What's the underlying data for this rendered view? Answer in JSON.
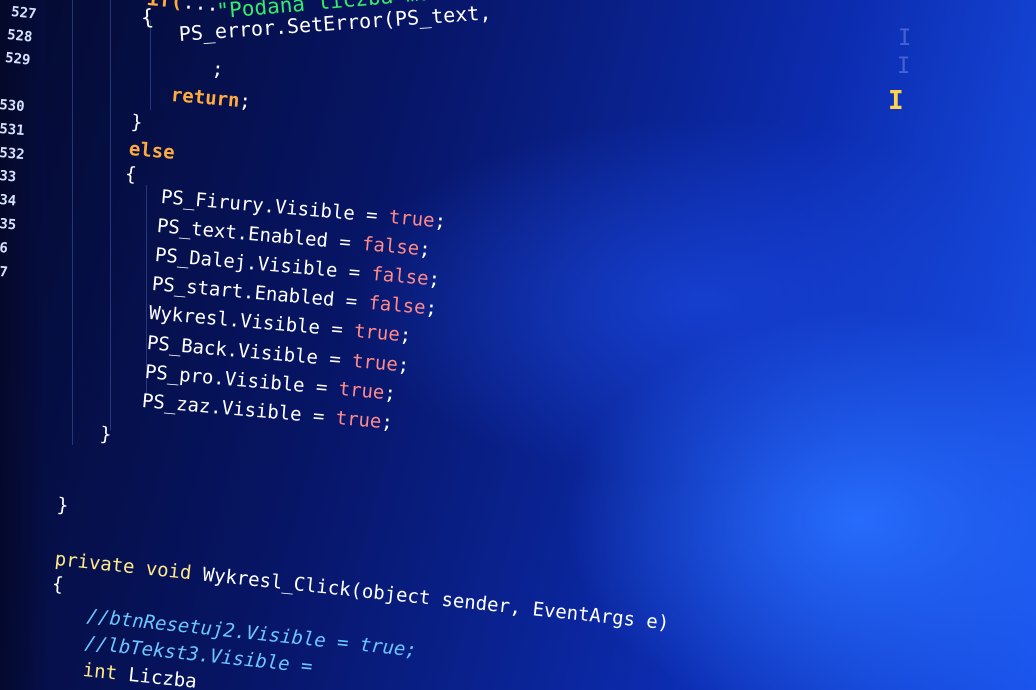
{
  "colors": {
    "identifier": "#ffffff",
    "keyword": "#ffab3d",
    "string": "#33ec68",
    "literal": "#ff8a8a",
    "type": "#ffe98a",
    "comment": "#6cc7ff",
    "background": "#0c2cb0"
  },
  "cursor": {
    "icon": "text-cursor-icon",
    "glyph": "I"
  },
  "line_numbers": [
    "527",
    "528",
    "529",
    "530",
    "531",
    "532",
    "33",
    "34",
    "35",
    "6",
    "7"
  ],
  "lines": [
    {
      "tokens": [
        {
          "t": "if(",
          "c": "kw"
        },
        {
          "t": "...",
          "c": "p"
        }
      ]
    },
    {
      "tokens": [
        {
          "t": "{",
          "c": "p"
        },
        {
          "t": "     ",
          "c": "p"
        },
        {
          "t": "\"Podana liczba musi być większa od",
          "c": "str"
        }
      ]
    },
    {
      "tokens": [
        {
          "t": "PS_error.SetError(PS_text, ",
          "c": "id"
        }
      ]
    },
    {
      "tokens": [
        {
          "t": ";",
          "c": "p"
        }
      ]
    },
    {
      "tokens": [
        {
          "t": "return",
          "c": "kw"
        },
        {
          "t": ";",
          "c": "p"
        }
      ]
    },
    {
      "tokens": [
        {
          "t": "}",
          "c": "p"
        }
      ]
    },
    {
      "tokens": [
        {
          "t": "else",
          "c": "kw"
        }
      ]
    },
    {
      "tokens": [
        {
          "t": "{",
          "c": "p"
        }
      ]
    },
    {
      "tokens": [
        {
          "t": "PS_Firury.Visible = ",
          "c": "id"
        },
        {
          "t": "true",
          "c": "lit"
        },
        {
          "t": ";",
          "c": "p"
        }
      ]
    },
    {
      "tokens": [
        {
          "t": "PS_text.Enabled = ",
          "c": "id"
        },
        {
          "t": "false",
          "c": "lit"
        },
        {
          "t": ";",
          "c": "p"
        }
      ]
    },
    {
      "tokens": [
        {
          "t": "PS_Dalej.Visible = ",
          "c": "id"
        },
        {
          "t": "false",
          "c": "lit"
        },
        {
          "t": ";",
          "c": "p"
        }
      ]
    },
    {
      "tokens": [
        {
          "t": "PS_start.Enabled = ",
          "c": "id"
        },
        {
          "t": "false",
          "c": "lit"
        },
        {
          "t": ";",
          "c": "p"
        }
      ]
    },
    {
      "tokens": [
        {
          "t": "Wykresl.Visible = ",
          "c": "id"
        },
        {
          "t": "true",
          "c": "lit"
        },
        {
          "t": ";",
          "c": "p"
        }
      ]
    },
    {
      "tokens": [
        {
          "t": "PS_Back.Visible = ",
          "c": "id"
        },
        {
          "t": "true",
          "c": "lit"
        },
        {
          "t": ";",
          "c": "p"
        }
      ]
    },
    {
      "tokens": [
        {
          "t": "PS_pro.Visible = ",
          "c": "id"
        },
        {
          "t": "true",
          "c": "lit"
        },
        {
          "t": ";",
          "c": "p"
        }
      ]
    },
    {
      "tokens": [
        {
          "t": "PS_zaz.Visible = ",
          "c": "id"
        },
        {
          "t": "true",
          "c": "lit"
        },
        {
          "t": ";",
          "c": "p"
        }
      ]
    },
    {
      "tokens": [
        {
          "t": "}",
          "c": "p"
        }
      ]
    },
    {
      "tokens": [
        {
          "t": "}",
          "c": "p"
        }
      ]
    },
    {
      "tokens": [
        {
          "t": "private void ",
          "c": "type"
        },
        {
          "t": "Wykresl_Click(object sender, EventArgs e)",
          "c": "id"
        }
      ]
    },
    {
      "tokens": [
        {
          "t": "{",
          "c": "p"
        }
      ]
    },
    {
      "tokens": [
        {
          "t": "//btnResetuj2.Visible = true;",
          "c": "cm"
        }
      ]
    },
    {
      "tokens": [
        {
          "t": "//lbTekst3.Visible = ",
          "c": "cm"
        }
      ]
    },
    {
      "tokens": [
        {
          "t": "int ",
          "c": "type"
        },
        {
          "t": "Liczba",
          "c": "id"
        }
      ]
    }
  ]
}
